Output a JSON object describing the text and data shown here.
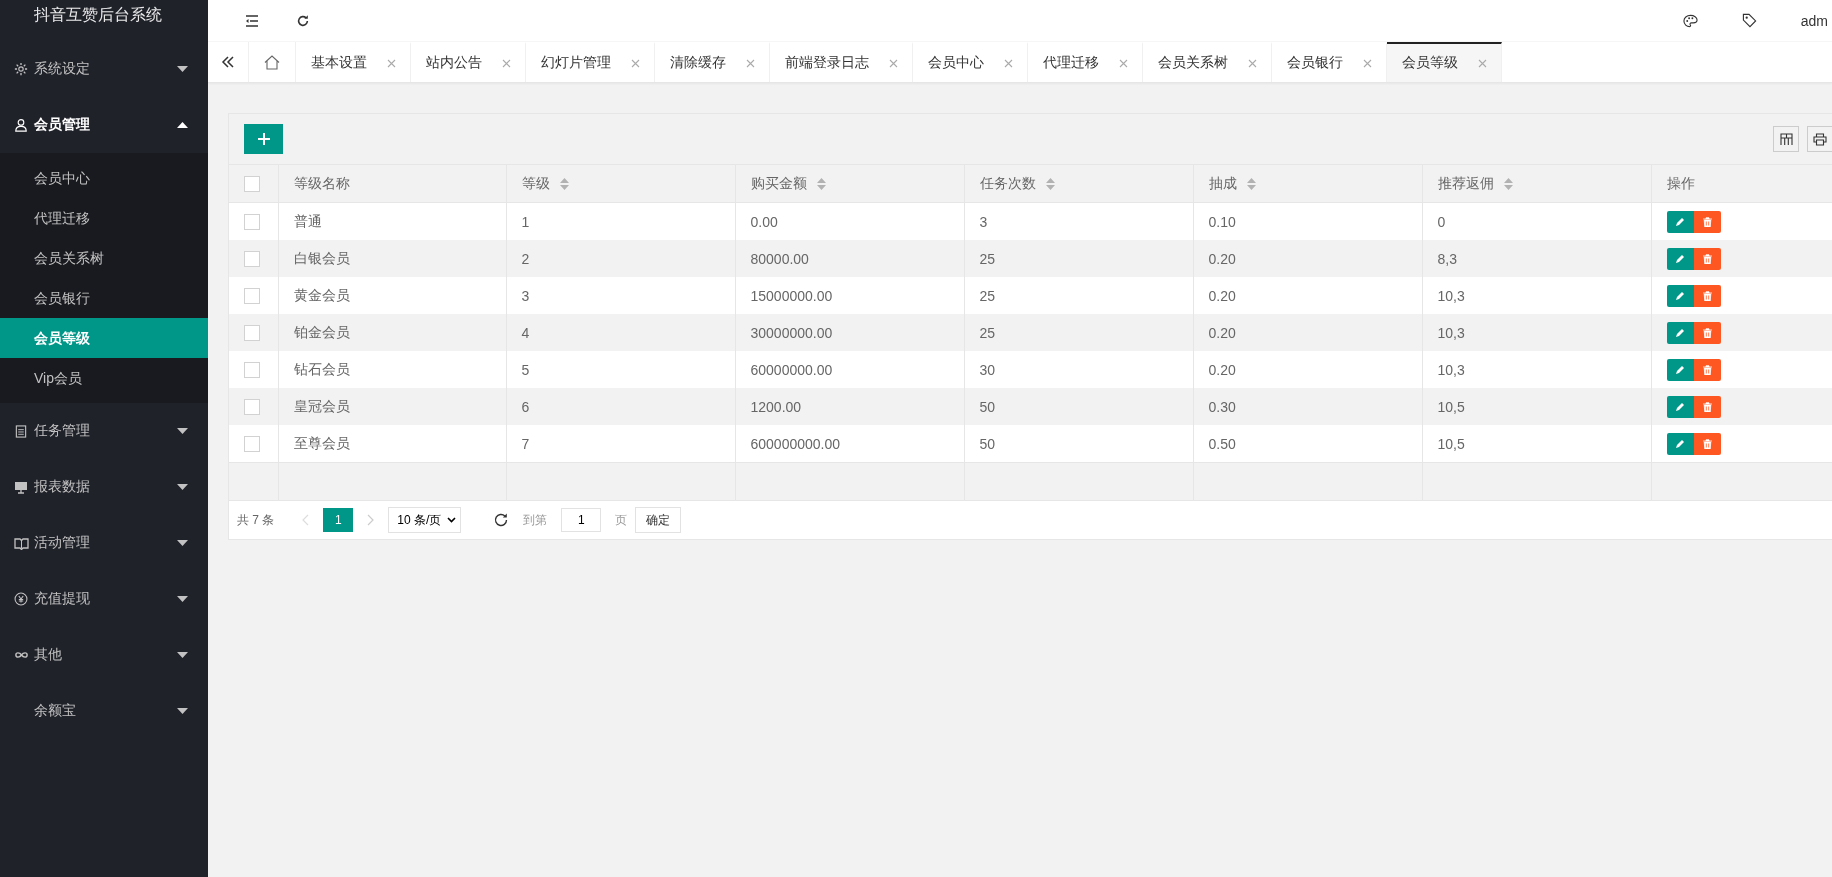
{
  "sidebar": {
    "title": "抖音互赞后台系统",
    "items": [
      {
        "label": "系统设定",
        "expanded": false
      },
      {
        "label": "会员管理",
        "expanded": true,
        "children": [
          {
            "label": "会员中心",
            "selected": false
          },
          {
            "label": "代理迁移",
            "selected": false
          },
          {
            "label": "会员关系树",
            "selected": false
          },
          {
            "label": "会员银行",
            "selected": false
          },
          {
            "label": "会员等级",
            "selected": true
          },
          {
            "label": "Vip会员",
            "selected": false
          }
        ]
      },
      {
        "label": "任务管理",
        "expanded": false
      },
      {
        "label": "报表数据",
        "expanded": false
      },
      {
        "label": "活动管理",
        "expanded": false
      },
      {
        "label": "充值提现",
        "expanded": false
      },
      {
        "label": "其他",
        "expanded": false
      },
      {
        "label": "余额宝",
        "expanded": false
      }
    ]
  },
  "header": {
    "user": "adm"
  },
  "tabs": [
    {
      "label": "基本设置",
      "selected": false
    },
    {
      "label": "站内公告",
      "selected": false
    },
    {
      "label": "幻灯片管理",
      "selected": false
    },
    {
      "label": "清除缓存",
      "selected": false
    },
    {
      "label": "前端登录日志",
      "selected": false
    },
    {
      "label": "会员中心",
      "selected": false
    },
    {
      "label": "代理迁移",
      "selected": false
    },
    {
      "label": "会员关系树",
      "selected": false
    },
    {
      "label": "会员银行",
      "selected": false
    },
    {
      "label": "会员等级",
      "selected": true
    }
  ],
  "table": {
    "all_checked": false,
    "columns": [
      {
        "label": "等级名称",
        "sortable": false
      },
      {
        "label": "等级",
        "sortable": true
      },
      {
        "label": "购买金额",
        "sortable": true
      },
      {
        "label": "任务次数",
        "sortable": true
      },
      {
        "label": "抽成",
        "sortable": true
      },
      {
        "label": "推荐返佣",
        "sortable": true
      },
      {
        "label": "操作",
        "sortable": false
      }
    ],
    "rows": [
      {
        "checked": false,
        "cells": [
          "普通",
          "1",
          "0.00",
          "3",
          "0.10",
          "0"
        ]
      },
      {
        "checked": false,
        "cells": [
          "白银会员",
          "2",
          "80000.00",
          "25",
          "0.20",
          "8,3"
        ]
      },
      {
        "checked": false,
        "cells": [
          "黄金会员",
          "3",
          "15000000.00",
          "25",
          "0.20",
          "10,3"
        ]
      },
      {
        "checked": false,
        "cells": [
          "铂金会员",
          "4",
          "30000000.00",
          "25",
          "0.20",
          "10,3"
        ]
      },
      {
        "checked": false,
        "cells": [
          "钻石会员",
          "5",
          "60000000.00",
          "30",
          "0.20",
          "10,3"
        ]
      },
      {
        "checked": false,
        "cells": [
          "皇冠会员",
          "6",
          "1200.00",
          "50",
          "0.30",
          "10,5"
        ]
      },
      {
        "checked": false,
        "cells": [
          "至尊会员",
          "7",
          "600000000.00",
          "50",
          "0.50",
          "10,5"
        ]
      }
    ]
  },
  "pagination": {
    "total": "共 7 条",
    "pages": [
      {
        "label": "1",
        "selected": true
      }
    ],
    "page_size": "10 条/页",
    "goto_label": "到第",
    "goto_value": "1",
    "page_unit": "页",
    "confirm": "确定"
  }
}
